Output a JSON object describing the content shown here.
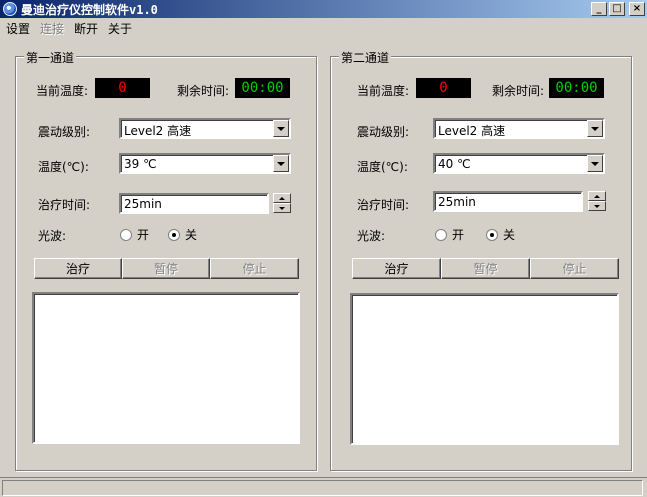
{
  "window": {
    "title": "曼迪治疗仪控制软件v1.0",
    "controls": [
      "_",
      "□",
      "×"
    ]
  },
  "menu": {
    "items": [
      {
        "label": "设置",
        "enabled": true
      },
      {
        "label": "连接",
        "enabled": false
      },
      {
        "label": "断开",
        "enabled": true
      },
      {
        "label": "关于",
        "enabled": true
      }
    ]
  },
  "channels": [
    {
      "group_title": "第一通道",
      "current_temp_label": "当前温度:",
      "current_temp_value": "0",
      "remaining_time_label": "剩余时间:",
      "remaining_time_value": "00:00",
      "vibration_label": "震动级别:",
      "vibration_value": "Level2 高速",
      "temperature_label": "温度(℃):",
      "temperature_value": "39 ℃",
      "treatment_time_label": "治疗时间:",
      "treatment_time_value": "25min",
      "lightwave_label": "光波:",
      "radio_on_label": "开",
      "radio_off_label": "关",
      "lightwave_selected": "关",
      "btn_treat": "治疗",
      "btn_pause": "暂停",
      "btn_stop": "停止"
    },
    {
      "group_title": "第二通道",
      "current_temp_label": "当前温度:",
      "current_temp_value": "0",
      "remaining_time_label": "剩余时间:",
      "remaining_time_value": "00:00",
      "vibration_label": "震动级别:",
      "vibration_value": "Level2 高速",
      "temperature_label": "温度(℃):",
      "temperature_value": "40 ℃",
      "treatment_time_label": "治疗时间:",
      "treatment_time_value": "25min",
      "lightwave_label": "光波:",
      "radio_on_label": "开",
      "radio_off_label": "关",
      "lightwave_selected": "关",
      "btn_treat": "治疗",
      "btn_pause": "暂停",
      "btn_stop": "停止"
    }
  ],
  "colors": {
    "temp_display": "#ff0000",
    "time_display": "#00d000",
    "window_bg": "#d4d0c8",
    "title_gradient_start": "#0a246a",
    "title_gradient_end": "#a6caf0"
  }
}
